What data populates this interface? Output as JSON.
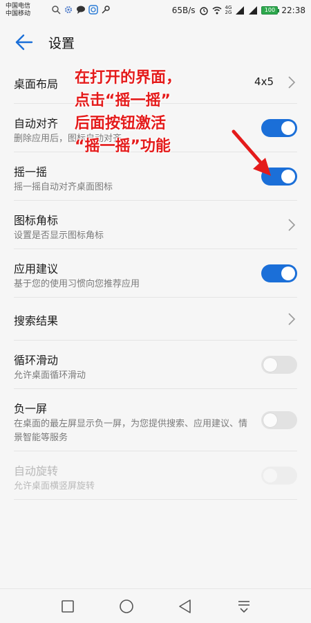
{
  "status_bar": {
    "carrier_1": "中国电信",
    "carrier_2": "中国移动",
    "network_speed": "65B/s",
    "network_label_top": "4G",
    "network_label_bottom": "2G",
    "battery": "100",
    "time": "22:38"
  },
  "header": {
    "title": "设置"
  },
  "settings": [
    {
      "title": "桌面布局",
      "subtitle": "",
      "value": "4x5",
      "control": "chevron"
    },
    {
      "title": "自动对齐",
      "subtitle": "删除应用后，图标自动对齐",
      "control": "toggle",
      "on": true
    },
    {
      "title": "摇一摇",
      "subtitle": "摇一摇自动对齐桌面图标",
      "control": "toggle",
      "on": true
    },
    {
      "title": "图标角标",
      "subtitle": "设置是否显示图标角标",
      "control": "chevron"
    },
    {
      "title": "应用建议",
      "subtitle": "基于您的使用习惯向您推荐应用",
      "control": "toggle",
      "on": true
    },
    {
      "title": "搜索结果",
      "subtitle": "",
      "control": "chevron"
    },
    {
      "title": "循环滑动",
      "subtitle": "允许桌面循环滑动",
      "control": "toggle",
      "on": false
    },
    {
      "title": "负一屏",
      "subtitle": "在桌面的最左屏显示负一屏，为您提供搜索、应用建议、情景智能等服务",
      "control": "toggle",
      "on": false
    },
    {
      "title": "自动旋转",
      "subtitle": "允许桌面横竖屏旋转",
      "control": "toggle",
      "on": false,
      "disabled": true
    }
  ],
  "annotation": {
    "lines": [
      "在打开的界面，",
      "点击“摇一摇”",
      "后面按钮激活",
      "“摇一摇”功能"
    ],
    "color": "#e41b1b"
  },
  "colors": {
    "accent": "#1b6fd8",
    "background": "#f6f6f6"
  }
}
